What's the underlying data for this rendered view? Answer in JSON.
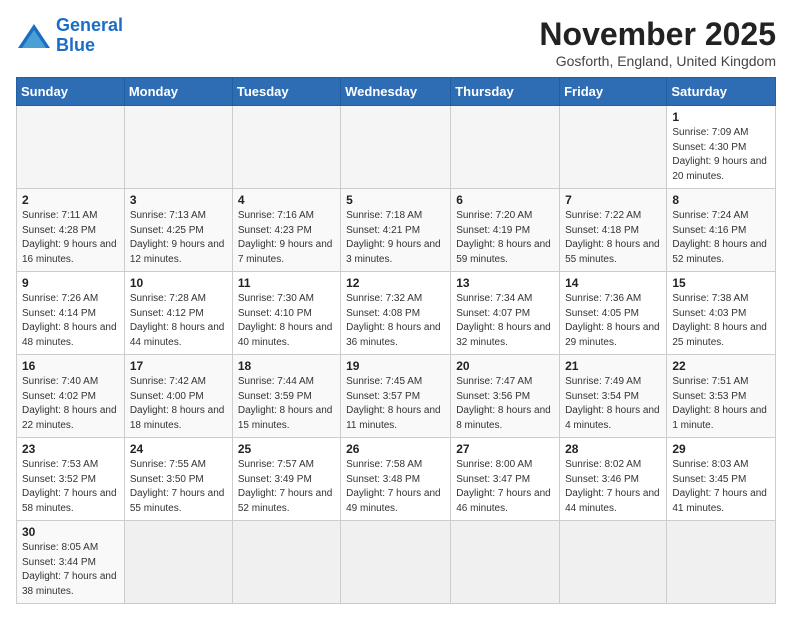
{
  "header": {
    "logo_general": "General",
    "logo_blue": "Blue",
    "month_title": "November 2025",
    "location": "Gosforth, England, United Kingdom"
  },
  "days_of_week": [
    "Sunday",
    "Monday",
    "Tuesday",
    "Wednesday",
    "Thursday",
    "Friday",
    "Saturday"
  ],
  "weeks": [
    [
      {
        "day": "",
        "info": ""
      },
      {
        "day": "",
        "info": ""
      },
      {
        "day": "",
        "info": ""
      },
      {
        "day": "",
        "info": ""
      },
      {
        "day": "",
        "info": ""
      },
      {
        "day": "",
        "info": ""
      },
      {
        "day": "1",
        "info": "Sunrise: 7:09 AM\nSunset: 4:30 PM\nDaylight: 9 hours and 20 minutes."
      }
    ],
    [
      {
        "day": "2",
        "info": "Sunrise: 7:11 AM\nSunset: 4:28 PM\nDaylight: 9 hours and 16 minutes."
      },
      {
        "day": "3",
        "info": "Sunrise: 7:13 AM\nSunset: 4:25 PM\nDaylight: 9 hours and 12 minutes."
      },
      {
        "day": "4",
        "info": "Sunrise: 7:16 AM\nSunset: 4:23 PM\nDaylight: 9 hours and 7 minutes."
      },
      {
        "day": "5",
        "info": "Sunrise: 7:18 AM\nSunset: 4:21 PM\nDaylight: 9 hours and 3 minutes."
      },
      {
        "day": "6",
        "info": "Sunrise: 7:20 AM\nSunset: 4:19 PM\nDaylight: 8 hours and 59 minutes."
      },
      {
        "day": "7",
        "info": "Sunrise: 7:22 AM\nSunset: 4:18 PM\nDaylight: 8 hours and 55 minutes."
      },
      {
        "day": "8",
        "info": "Sunrise: 7:24 AM\nSunset: 4:16 PM\nDaylight: 8 hours and 52 minutes."
      }
    ],
    [
      {
        "day": "9",
        "info": "Sunrise: 7:26 AM\nSunset: 4:14 PM\nDaylight: 8 hours and 48 minutes."
      },
      {
        "day": "10",
        "info": "Sunrise: 7:28 AM\nSunset: 4:12 PM\nDaylight: 8 hours and 44 minutes."
      },
      {
        "day": "11",
        "info": "Sunrise: 7:30 AM\nSunset: 4:10 PM\nDaylight: 8 hours and 40 minutes."
      },
      {
        "day": "12",
        "info": "Sunrise: 7:32 AM\nSunset: 4:08 PM\nDaylight: 8 hours and 36 minutes."
      },
      {
        "day": "13",
        "info": "Sunrise: 7:34 AM\nSunset: 4:07 PM\nDaylight: 8 hours and 32 minutes."
      },
      {
        "day": "14",
        "info": "Sunrise: 7:36 AM\nSunset: 4:05 PM\nDaylight: 8 hours and 29 minutes."
      },
      {
        "day": "15",
        "info": "Sunrise: 7:38 AM\nSunset: 4:03 PM\nDaylight: 8 hours and 25 minutes."
      }
    ],
    [
      {
        "day": "16",
        "info": "Sunrise: 7:40 AM\nSunset: 4:02 PM\nDaylight: 8 hours and 22 minutes."
      },
      {
        "day": "17",
        "info": "Sunrise: 7:42 AM\nSunset: 4:00 PM\nDaylight: 8 hours and 18 minutes."
      },
      {
        "day": "18",
        "info": "Sunrise: 7:44 AM\nSunset: 3:59 PM\nDaylight: 8 hours and 15 minutes."
      },
      {
        "day": "19",
        "info": "Sunrise: 7:45 AM\nSunset: 3:57 PM\nDaylight: 8 hours and 11 minutes."
      },
      {
        "day": "20",
        "info": "Sunrise: 7:47 AM\nSunset: 3:56 PM\nDaylight: 8 hours and 8 minutes."
      },
      {
        "day": "21",
        "info": "Sunrise: 7:49 AM\nSunset: 3:54 PM\nDaylight: 8 hours and 4 minutes."
      },
      {
        "day": "22",
        "info": "Sunrise: 7:51 AM\nSunset: 3:53 PM\nDaylight: 8 hours and 1 minute."
      }
    ],
    [
      {
        "day": "23",
        "info": "Sunrise: 7:53 AM\nSunset: 3:52 PM\nDaylight: 7 hours and 58 minutes."
      },
      {
        "day": "24",
        "info": "Sunrise: 7:55 AM\nSunset: 3:50 PM\nDaylight: 7 hours and 55 minutes."
      },
      {
        "day": "25",
        "info": "Sunrise: 7:57 AM\nSunset: 3:49 PM\nDaylight: 7 hours and 52 minutes."
      },
      {
        "day": "26",
        "info": "Sunrise: 7:58 AM\nSunset: 3:48 PM\nDaylight: 7 hours and 49 minutes."
      },
      {
        "day": "27",
        "info": "Sunrise: 8:00 AM\nSunset: 3:47 PM\nDaylight: 7 hours and 46 minutes."
      },
      {
        "day": "28",
        "info": "Sunrise: 8:02 AM\nSunset: 3:46 PM\nDaylight: 7 hours and 44 minutes."
      },
      {
        "day": "29",
        "info": "Sunrise: 8:03 AM\nSunset: 3:45 PM\nDaylight: 7 hours and 41 minutes."
      }
    ],
    [
      {
        "day": "30",
        "info": "Sunrise: 8:05 AM\nSunset: 3:44 PM\nDaylight: 7 hours and 38 minutes."
      },
      {
        "day": "",
        "info": ""
      },
      {
        "day": "",
        "info": ""
      },
      {
        "day": "",
        "info": ""
      },
      {
        "day": "",
        "info": ""
      },
      {
        "day": "",
        "info": ""
      },
      {
        "day": "",
        "info": ""
      }
    ]
  ]
}
